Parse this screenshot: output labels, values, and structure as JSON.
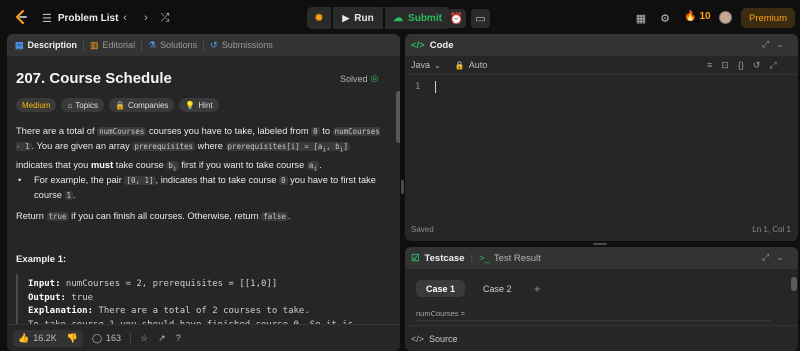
{
  "nav": {
    "problem_list": "Problem List",
    "run": "Run",
    "submit": "Submit",
    "streak": "10",
    "premium": "Premium"
  },
  "left_tabs": [
    "Description",
    "Editorial",
    "Solutions",
    "Submissions"
  ],
  "problem": {
    "title": "207. Course Schedule",
    "status": "Solved",
    "tags": [
      "Medium",
      "Topics",
      "Companies",
      "Hint"
    ]
  },
  "description": {
    "p1_a": "There are a total of ",
    "p1_code1": "numCourses",
    "p1_b": " courses you have to take, labeled from ",
    "p1_code2": "0",
    "p1_c": " to ",
    "p1_code3": "numCourses - 1",
    "p1_d": ". You are given an array ",
    "p1_code4": "prerequisites",
    "p1_e": " where ",
    "p1_code5": "prerequisites[i] = [a",
    "p1_code5_sub": "i",
    "p1_code5b": ", b",
    "p1_code5b_sub": "i",
    "p1_code5c": "]",
    "p1_f": " indicates that you ",
    "p1_must": "must",
    "p1_g": " take course ",
    "p1_code6": "b",
    "p1_code6_sub": "i",
    "p1_h": " first if you want to take course ",
    "p1_code7": "a",
    "p1_code7_sub": "i",
    "p1_i": ".",
    "bullet_a": "For example, the pair ",
    "bullet_code1": "[0, 1]",
    "bullet_b": ", indicates that to take course ",
    "bullet_code2": "0",
    "bullet_c": " you have to first take course ",
    "bullet_code3": "1",
    "bullet_d": ".",
    "p2_a": "Return ",
    "p2_code1": "true",
    "p2_b": " if you can finish all courses. Otherwise, return ",
    "p2_code2": "false",
    "p2_c": "."
  },
  "example": {
    "heading": "Example 1:",
    "input_label": "Input:",
    "input_value": " numCourses = 2, prerequisites = [[1,0]]",
    "output_label": "Output:",
    "output_value": " true",
    "explanation_label": "Explanation:",
    "explanation_value": " There are a total of 2 courses to take.",
    "explanation_line2": "To take course 1 you should have finished course 0. So it is"
  },
  "footer": {
    "likes": "16.2K",
    "comments": "163"
  },
  "code": {
    "title": "Code",
    "language": "Java",
    "mode": "Auto",
    "line1": "1",
    "saved": "Saved",
    "cursor": "Ln 1, Col 1"
  },
  "test": {
    "tab_testcase": "Testcase",
    "tab_result": "Test Result",
    "cases": [
      "Case 1",
      "Case 2"
    ],
    "param_label": "numCourses =",
    "source": "Source"
  },
  "colors": {
    "accent_orange": "#ffa116",
    "green": "#2cbb5d",
    "medium": "#ffb800"
  }
}
